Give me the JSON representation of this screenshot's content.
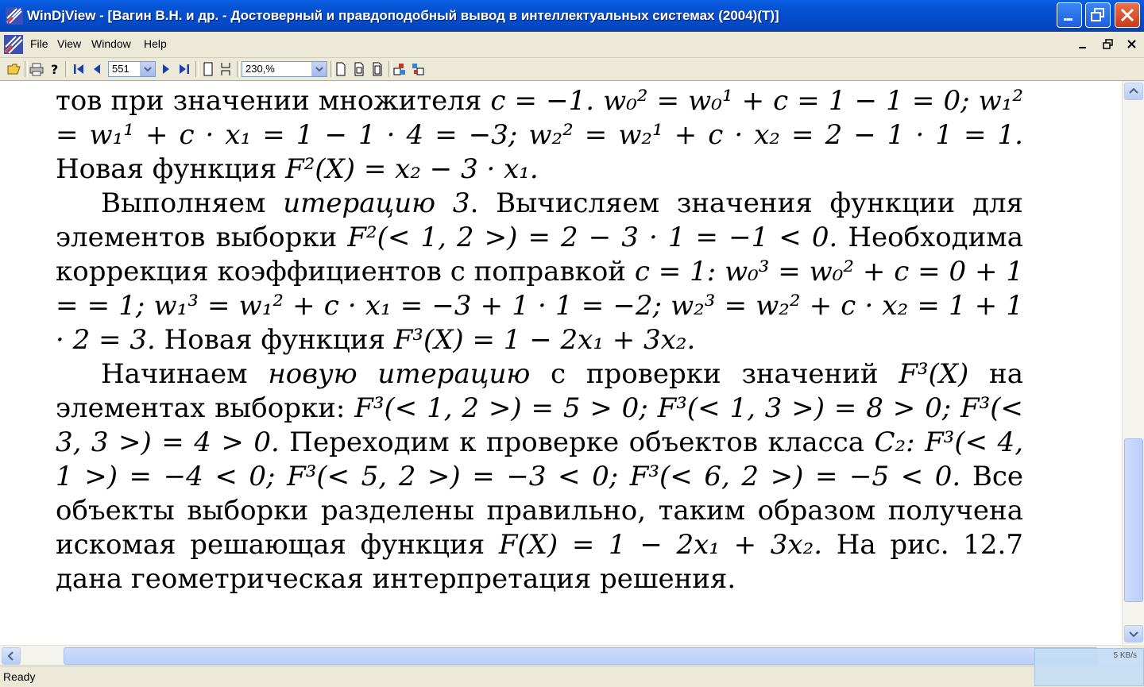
{
  "window": {
    "title": "WinDjView - [Вагин В.Н. и др. - Достоверный и правдоподобный вывод в интеллектуальных системах (2004)(T)]"
  },
  "menu": [
    "File",
    "View",
    "Window",
    "Help"
  ],
  "toolbar": {
    "page_number": "551",
    "zoom": "230,%"
  },
  "status": {
    "text": "Ready",
    "net_speed": "5 KB/s"
  },
  "colors": {
    "title_blue": "#0654d6",
    "close_red": "#c9391a",
    "chrome": "#ece9d8"
  },
  "icons": [
    "open-icon",
    "print-icon",
    "help-icon",
    "first-page-icon",
    "prev-page-icon",
    "next-page-icon",
    "last-page-icon",
    "single-page-icon",
    "continuous-icon",
    "actual-size-icon",
    "fit-width-icon",
    "fit-page-icon",
    "rotate-left-icon",
    "rotate-right-icon"
  ],
  "doc": {
    "p1": {
      "t1": "тов при значении множителя ",
      "t2": ". ",
      "t3": " Новая функция "
    },
    "p2": {
      "t1": "Выполняем ",
      "em1": "итерацию 3",
      "t2": ". Вычисляем значения функции для элементов выборки ",
      "t3": " Необходима коррекция коэффициентов с поправкой ",
      "t4": " Новая функция "
    },
    "p3": {
      "t1": "Начинаем ",
      "em1": "новую итерацию",
      "t2": " с проверки значений ",
      "t3": " на элементах выборки: ",
      "t4": " Переходим к проверке объектов класса ",
      "t5": " Все объекты выборки разделены правильно, таким образом получена искомая решающая функция ",
      "t6": " На рис. 12.7 дана геометрическая интерпретация решения."
    },
    "math": {
      "m1": "c = −1.",
      "m2": "w₀² = w₀¹ + c = 1 − 1 = 0;",
      "m3": "w₁² = w₁¹ + c · x₁ = 1 − 1 · 4 = −3;",
      "m4": "w₂² = w₂¹ + c · x₂ = 2 − 1 · 1 = 1.",
      "m5": "F²(X) = x₂ − 3 · x₁.",
      "m6": "F²(< 1, 2 >) = 2 − 3 · 1 = −1 < 0.",
      "m7": "c = 1:",
      "m8": "w₀³ = w₀² + c = 0 + 1 = = 1;",
      "m9": "w₁³ = w₁² + c · x₁ = −3 + 1 · 1 = −2;",
      "m10": "w₂³ = w₂² + c · x₂ = 1 + 1 · 2 = 3.",
      "m11": "F³(X) = 1 − 2x₁ + 3x₂.",
      "m12": "F³(X)",
      "m13": "F³(< 1, 2 >) = 5 > 0;",
      "m14": "F³(< 1, 3 >) = 8 > 0;",
      "m15": "F³(< 3, 3 >) = 4 > 0.",
      "m16": "C₂:",
      "m17": "F³(< 4, 1 >) = −4 < 0;",
      "m18": "F³(< 5, 2 >) = −3 < 0;",
      "m19": "F³(< 6, 2 >) = −5 < 0.",
      "m20": "F(X) = 1 − 2x₁ + 3x₂."
    }
  }
}
